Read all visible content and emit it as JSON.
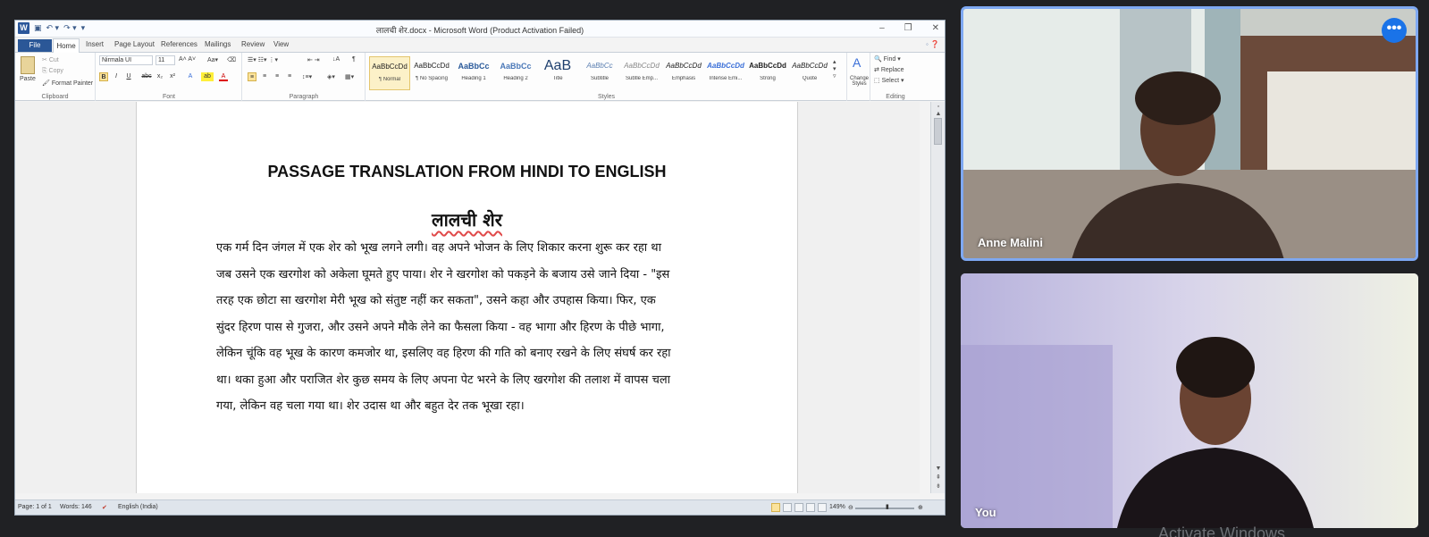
{
  "word": {
    "title": "लालची शेर.docx - Microsoft Word (Product Activation Failed)",
    "tabs": [
      "File",
      "Home",
      "Insert",
      "Page Layout",
      "References",
      "Mailings",
      "Review",
      "View"
    ],
    "clipboard": {
      "paste": "Paste",
      "cut": "Cut",
      "copy": "Copy",
      "format_painter": "Format Painter",
      "label": "Clipboard"
    },
    "font": {
      "family": "Nirmala UI",
      "size": "11",
      "label": "Font",
      "buttons": [
        "B",
        "I",
        "U",
        "abc",
        "x₂",
        "x²",
        "A",
        "ab",
        "A"
      ]
    },
    "paragraph": {
      "label": "Paragraph"
    },
    "styles": {
      "label": "Styles",
      "items": [
        {
          "preview": "AaBbCcDd",
          "name": "¶ Normal"
        },
        {
          "preview": "AaBbCcDd",
          "name": "¶ No Spacing"
        },
        {
          "preview": "AaBbCc",
          "name": "Heading 1"
        },
        {
          "preview": "AaBbCc",
          "name": "Heading 2"
        },
        {
          "preview": "AaB",
          "name": "Title"
        },
        {
          "preview": "AaBbCc",
          "name": "Subtitle"
        },
        {
          "preview": "AaBbCcDd",
          "name": "Subtle Emp..."
        },
        {
          "preview": "AaBbCcDd",
          "name": "Emphasis"
        },
        {
          "preview": "AaBbCcDd",
          "name": "Intense Emi..."
        },
        {
          "preview": "AaBbCcDd",
          "name": "Strong"
        },
        {
          "preview": "AaBbCcDd",
          "name": "Quote"
        }
      ],
      "change_styles": "Change Styles"
    },
    "editing": {
      "find": "Find",
      "replace": "Replace",
      "select": "Select",
      "label": "Editing"
    },
    "document": {
      "heading": "PASSAGE TRANSLATION FROM HINDI TO ENGLISH",
      "title": "लालची शेर",
      "lines": [
        "एक गर्म दिन जंगल में एक शेर को भूख लगने लगी। वह अपने भोजन के लिए शिकार करना शुरू कर रहा था",
        "जब उसने एक खरगोश को अकेला घूमते हुए पाया। शेर ने खरगोश को पकड़ने के बजाय उसे जाने दिया - \"इस",
        "तरह एक छोटा सा खरगोश मेरी भूख को संतुष्ट नहीं कर सकता\", उसने कहा और उपहास किया। फिर, एक",
        "सुंदर हिरण पास से गुजरा, और उसने अपने मौके लेने का फैसला किया - वह भागा और हिरण के पीछे भागा,",
        "लेकिन चूंकि वह भूख के कारण कमजोर था, इसलिए वह हिरण की गति को बनाए रखने के लिए संघर्ष कर रहा",
        "था। थका हुआ और पराजित शेर कुछ समय के लिए अपना पेट भरने के लिए खरगोश की तलाश में वापस चला",
        "गया, लेकिन वह चला गया था। शेर उदास था और बहुत देर तक भूखा रहा।"
      ]
    },
    "status": {
      "page": "Page: 1 of 1",
      "words": "Words: 146",
      "language": "English (India)",
      "zoom": "149%"
    }
  },
  "meeting": {
    "participants": [
      {
        "name": "Anne Malini"
      },
      {
        "name": "You"
      }
    ],
    "more_icon": "•••"
  },
  "watermark": "Activate Windows"
}
